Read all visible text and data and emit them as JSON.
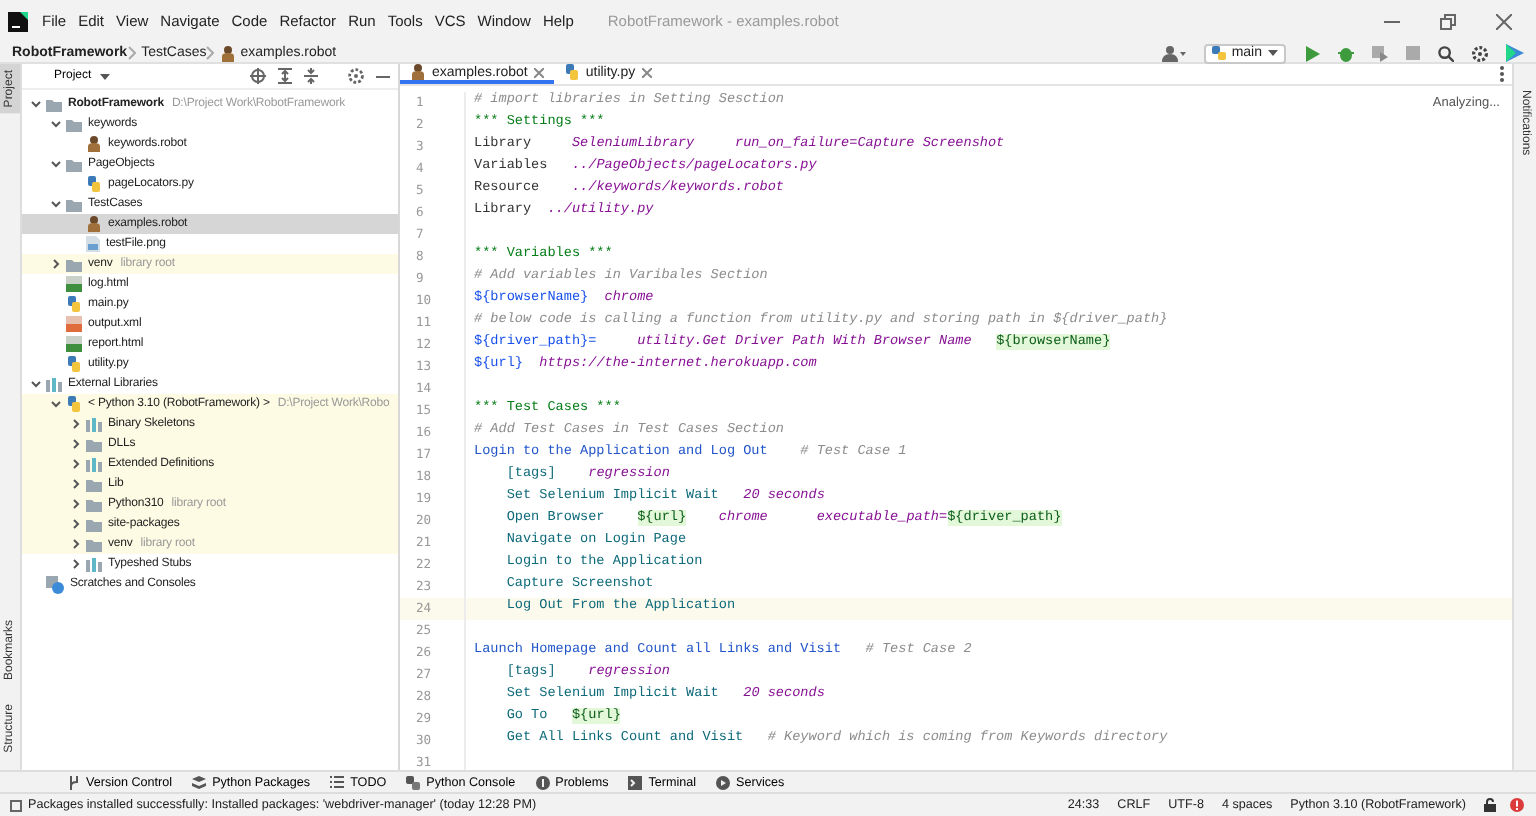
{
  "title_bar": {
    "menu": [
      "File",
      "Edit",
      "View",
      "Navigate",
      "Code",
      "Refactor",
      "Run",
      "Tools",
      "VCS",
      "Window",
      "Help"
    ],
    "title": "RobotFramework - examples.robot"
  },
  "navigation_bar": {
    "breadcrumbs": [
      {
        "label": "RobotFramework",
        "kind": "project"
      },
      {
        "label": "TestCases",
        "kind": "folder"
      },
      {
        "label": "examples.robot",
        "kind": "robot"
      }
    ],
    "branch": "main"
  },
  "side_tabs": {
    "left_top": [
      {
        "label": "Project",
        "selected": true
      }
    ],
    "left_bottom": [
      {
        "label": "Bookmarks",
        "selected": false
      },
      {
        "label": "Structure",
        "selected": false
      }
    ],
    "right": [
      {
        "label": "Notifications",
        "selected": false
      }
    ]
  },
  "project_panel": {
    "title": "Project",
    "tree": [
      {
        "label": "RobotFramework",
        "kind": "project",
        "note": "D:\\Project Work\\RobotFramework",
        "expanded": true,
        "selected": false,
        "shaded": false,
        "children": [
          {
            "label": "keywords",
            "kind": "folder",
            "expanded": true,
            "selected": false,
            "shaded": false,
            "children": [
              {
                "label": "keywords.robot",
                "kind": "robot",
                "selected": false,
                "shaded": false
              }
            ]
          },
          {
            "label": "PageObjects",
            "kind": "folder",
            "expanded": true,
            "selected": false,
            "shaded": false,
            "children": [
              {
                "label": "pageLocators.py",
                "kind": "py",
                "selected": false,
                "shaded": false
              }
            ]
          },
          {
            "label": "TestCases",
            "kind": "folder",
            "expanded": true,
            "selected": false,
            "shaded": false,
            "children": [
              {
                "label": "examples.robot",
                "kind": "robot",
                "selected": true,
                "shaded": false
              },
              {
                "label": "testFile.png",
                "kind": "png",
                "selected": false,
                "shaded": false
              }
            ]
          },
          {
            "label": "venv",
            "kind": "folder",
            "note": "library root",
            "expanded": false,
            "selected": false,
            "shaded": true
          },
          {
            "label": "log.html",
            "kind": "html",
            "selected": false,
            "shaded": false
          },
          {
            "label": "main.py",
            "kind": "py",
            "selected": false,
            "shaded": false
          },
          {
            "label": "output.xml",
            "kind": "xml",
            "selected": false,
            "shaded": false
          },
          {
            "label": "report.html",
            "kind": "html",
            "selected": false,
            "shaded": false
          },
          {
            "label": "utility.py",
            "kind": "py",
            "selected": false,
            "shaded": false
          }
        ]
      },
      {
        "label": "External Libraries",
        "kind": "libraries",
        "expanded": true,
        "selected": false,
        "shaded": false,
        "children": [
          {
            "label": "< Python 3.10 (RobotFramework) >",
            "kind": "sdk",
            "note": "D:\\Project Work\\Robo",
            "expanded": true,
            "selected": false,
            "shaded": true,
            "children": [
              {
                "label": "Binary Skeletons",
                "kind": "libfolder",
                "expanded": false,
                "selected": false,
                "shaded": true
              },
              {
                "label": "DLLs",
                "kind": "folder",
                "expanded": false,
                "selected": false,
                "shaded": true
              },
              {
                "label": "Extended Definitions",
                "kind": "libfolder",
                "expanded": false,
                "selected": false,
                "shaded": true
              },
              {
                "label": "Lib",
                "kind": "folder",
                "expanded": false,
                "selected": false,
                "shaded": true
              },
              {
                "label": "Python310",
                "kind": "folder",
                "note": "library root",
                "expanded": false,
                "selected": false,
                "shaded": true
              },
              {
                "label": "site-packages",
                "kind": "folder",
                "expanded": false,
                "selected": false,
                "shaded": true
              },
              {
                "label": "venv",
                "kind": "folder",
                "note": "library root",
                "expanded": false,
                "selected": false,
                "shaded": true
              },
              {
                "label": "Typeshed Stubs",
                "kind": "libfolder",
                "expanded": false,
                "selected": false,
                "shaded": false
              }
            ]
          }
        ]
      },
      {
        "label": "Scratches and Consoles",
        "kind": "scratches",
        "selected": false,
        "shaded": false
      }
    ]
  },
  "editor": {
    "tabs": [
      {
        "label": "examples.robot",
        "kind": "robot",
        "selected": true
      },
      {
        "label": "utility.py",
        "kind": "py",
        "selected": false
      }
    ],
    "status": "Analyzing...",
    "lines": [
      {
        "number": "1",
        "current": false,
        "tokens": [
          {
            "kind": "comment",
            "text": "# import libraries in Setting Sesction"
          }
        ]
      },
      {
        "number": "2",
        "current": false,
        "tokens": [
          {
            "kind": "section",
            "text": "*** Settings ***"
          }
        ]
      },
      {
        "number": "3",
        "current": false,
        "tokens": [
          {
            "kind": "setting",
            "text": "Library     "
          },
          {
            "kind": "arg",
            "text": "SeleniumLibrary     run_on_failure=Capture Screenshot"
          }
        ]
      },
      {
        "number": "4",
        "current": false,
        "tokens": [
          {
            "kind": "setting",
            "text": "Variables   "
          },
          {
            "kind": "arg",
            "text": "../PageObjects/pageLocators.py"
          }
        ]
      },
      {
        "number": "5",
        "current": false,
        "tokens": [
          {
            "kind": "setting",
            "text": "Resource    "
          },
          {
            "kind": "arg",
            "text": "../keywords/keywords.robot"
          }
        ]
      },
      {
        "number": "6",
        "current": false,
        "tokens": [
          {
            "kind": "setting",
            "text": "Library  "
          },
          {
            "kind": "arg",
            "text": "../utility.py"
          }
        ]
      },
      {
        "number": "7",
        "current": false
      },
      {
        "number": "8",
        "current": false,
        "tokens": [
          {
            "kind": "section",
            "text": "*** Variables ***"
          }
        ]
      },
      {
        "number": "9",
        "current": false,
        "tokens": [
          {
            "kind": "comment",
            "text": "# Add variables in Varibales Section"
          }
        ]
      },
      {
        "number": "10",
        "current": false,
        "tokens": [
          {
            "kind": "variable",
            "text": "${browserName}"
          },
          {
            "kind": "arg",
            "text": "  chrome"
          }
        ]
      },
      {
        "number": "11",
        "current": false,
        "tokens": [
          {
            "kind": "comment",
            "text": "# below code is calling a function from utility.py and storing path in ${driver_path}"
          }
        ]
      },
      {
        "number": "12",
        "current": false,
        "tokens": [
          {
            "kind": "variable",
            "text": "${driver_path}="
          },
          {
            "kind": "arg",
            "text": "     utility.Get Driver Path With Browser Name   "
          },
          {
            "kind": "highlight",
            "text": "${browserName}"
          }
        ]
      },
      {
        "number": "13",
        "current": false,
        "tokens": [
          {
            "kind": "variable",
            "text": "${url}"
          },
          {
            "kind": "arg",
            "text": "  https://the-internet.herokuapp.com"
          }
        ]
      },
      {
        "number": "14",
        "current": false
      },
      {
        "number": "15",
        "current": false,
        "tokens": [
          {
            "kind": "section",
            "text": "*** Test Cases ***"
          }
        ]
      },
      {
        "number": "16",
        "current": false,
        "tokens": [
          {
            "kind": "comment",
            "text": "# Add Test Cases in Test Cases Section"
          }
        ]
      },
      {
        "number": "17",
        "current": false,
        "tokens": [
          {
            "kind": "testcase",
            "text": "Login to the Application and Log Out    "
          },
          {
            "kind": "comment",
            "text": "# Test Case 1"
          }
        ]
      },
      {
        "number": "18",
        "current": false,
        "tokens": [
          {
            "kind": "keyword",
            "text": "    [tags]    "
          },
          {
            "kind": "arg",
            "text": "regression"
          }
        ]
      },
      {
        "number": "19",
        "current": false,
        "tokens": [
          {
            "kind": "keyword",
            "text": "    Set Selenium Implicit Wait   "
          },
          {
            "kind": "arg",
            "text": "20 seconds"
          }
        ]
      },
      {
        "number": "20",
        "current": false,
        "tokens": [
          {
            "kind": "keyword",
            "text": "    Open Browser    "
          },
          {
            "kind": "highlight",
            "text": "${url}"
          },
          {
            "kind": "arg",
            "text": "    chrome      executable_path="
          },
          {
            "kind": "highlight",
            "text": "${driver_path}"
          }
        ]
      },
      {
        "number": "21",
        "current": false,
        "tokens": [
          {
            "kind": "keyword",
            "text": "    Navigate on Login Page"
          }
        ]
      },
      {
        "number": "22",
        "current": false,
        "tokens": [
          {
            "kind": "keyword",
            "text": "    Login to the Application"
          }
        ]
      },
      {
        "number": "23",
        "current": false,
        "tokens": [
          {
            "kind": "keyword",
            "text": "    Capture Screenshot"
          }
        ]
      },
      {
        "number": "24",
        "current": true,
        "tokens": [
          {
            "kind": "keyword",
            "text": "    Log Out From the Application"
          }
        ]
      },
      {
        "number": "25",
        "current": false
      },
      {
        "number": "26",
        "current": false,
        "tokens": [
          {
            "kind": "testcase",
            "text": "Launch Homepage and Count all Links and Visit   "
          },
          {
            "kind": "comment",
            "text": "# Test Case 2"
          }
        ]
      },
      {
        "number": "27",
        "current": false,
        "tokens": [
          {
            "kind": "keyword",
            "text": "    [tags]    "
          },
          {
            "kind": "arg",
            "text": "regression"
          }
        ]
      },
      {
        "number": "28",
        "current": false,
        "tokens": [
          {
            "kind": "keyword",
            "text": "    Set Selenium Implicit Wait   "
          },
          {
            "kind": "arg",
            "text": "20 seconds"
          }
        ]
      },
      {
        "number": "29",
        "current": false,
        "tokens": [
          {
            "kind": "keyword",
            "text": "    Go To   "
          },
          {
            "kind": "highlight",
            "text": "${url}"
          }
        ]
      },
      {
        "number": "30",
        "current": false,
        "tokens": [
          {
            "kind": "keyword",
            "text": "    Get All Links Count and Visit   "
          },
          {
            "kind": "comment",
            "text": "# Keyword which is coming from Keywords directory"
          }
        ]
      },
      {
        "number": "31",
        "current": false
      }
    ]
  },
  "tool_windows": [
    {
      "label": "Version Control",
      "kind": "vcs"
    },
    {
      "label": "Python Packages",
      "kind": "packages"
    },
    {
      "label": "TODO",
      "kind": "todo"
    },
    {
      "label": "Python Console",
      "kind": "console"
    },
    {
      "label": "Problems",
      "kind": "problems"
    },
    {
      "label": "Terminal",
      "kind": "terminal"
    },
    {
      "label": "Services",
      "kind": "services"
    }
  ],
  "status_bar": {
    "message": "Packages installed successfully: Installed packages: 'webdriver-manager' (today 12:28 PM)",
    "items": [
      "24:33",
      "CRLF",
      "UTF-8",
      "4 spaces",
      "Python 3.10 (RobotFramework)"
    ]
  }
}
